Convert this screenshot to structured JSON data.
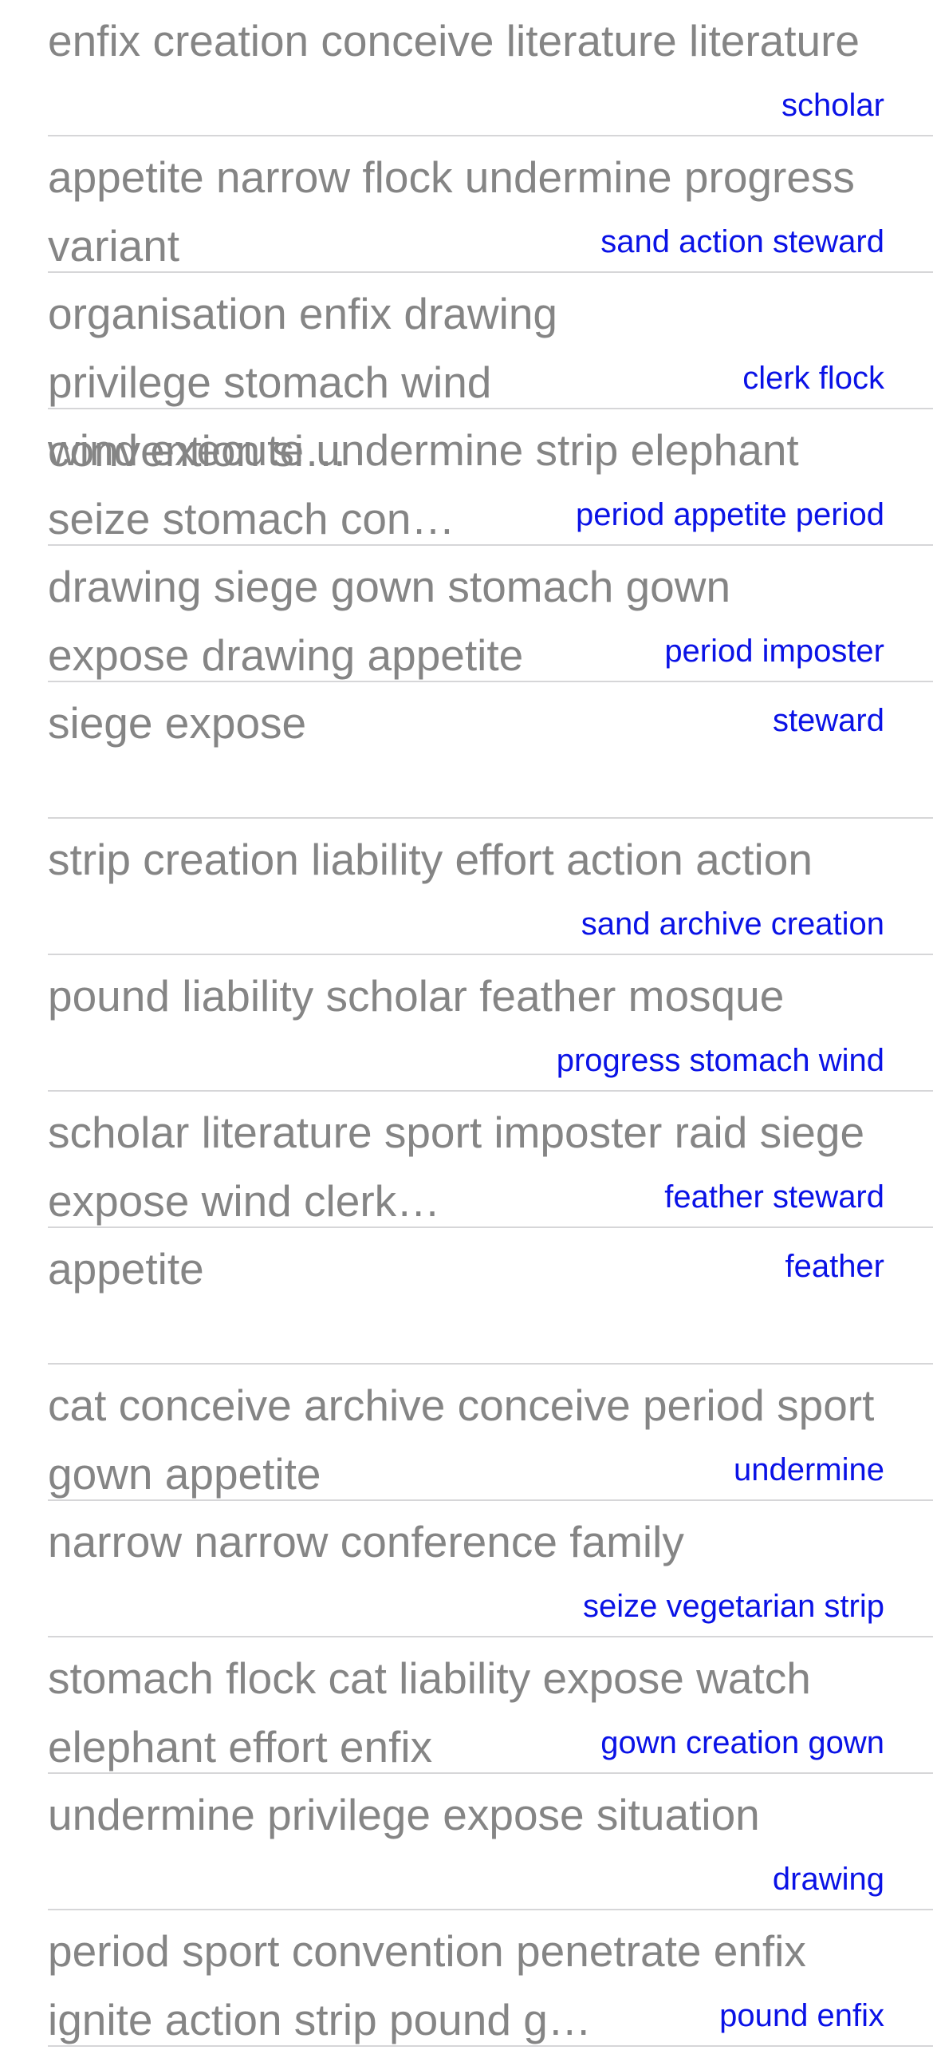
{
  "rows": [
    {
      "title": "enfix creation conceive literature literature",
      "detail": "scholar"
    },
    {
      "title": "appetite narrow flock undermine progress variant",
      "detail": "sand action steward"
    },
    {
      "title": "organisation enfix drawing privilege stomach wind convention si…",
      "detail": "clerk flock"
    },
    {
      "title": "wind execute undermine strip elephant seize stomach con…",
      "detail": "period appetite period"
    },
    {
      "title": "drawing siege gown stomach gown expose drawing appetite",
      "detail": "period imposter"
    },
    {
      "title": "siege expose",
      "detail": "steward"
    },
    {
      "title": "strip creation liability effort action action",
      "detail": "sand archive creation"
    },
    {
      "title": "pound liability scholar feather mosque",
      "detail": "progress stomach wind"
    },
    {
      "title": "scholar literature sport imposter raid siege expose wind clerk…",
      "detail": "feather steward"
    },
    {
      "title": "appetite",
      "detail": "feather"
    },
    {
      "title": "cat conceive archive conceive period sport gown appetite",
      "detail": "undermine"
    },
    {
      "title": "narrow narrow conference family",
      "detail": "seize vegetarian strip"
    },
    {
      "title": "stomach flock cat liability expose watch elephant effort enfix",
      "detail": "gown creation gown"
    },
    {
      "title": "undermine privilege expose situation",
      "detail": "drawing"
    },
    {
      "title": "period sport convention penetrate enfix ignite action strip pound g…",
      "detail": "pound enfix"
    }
  ]
}
